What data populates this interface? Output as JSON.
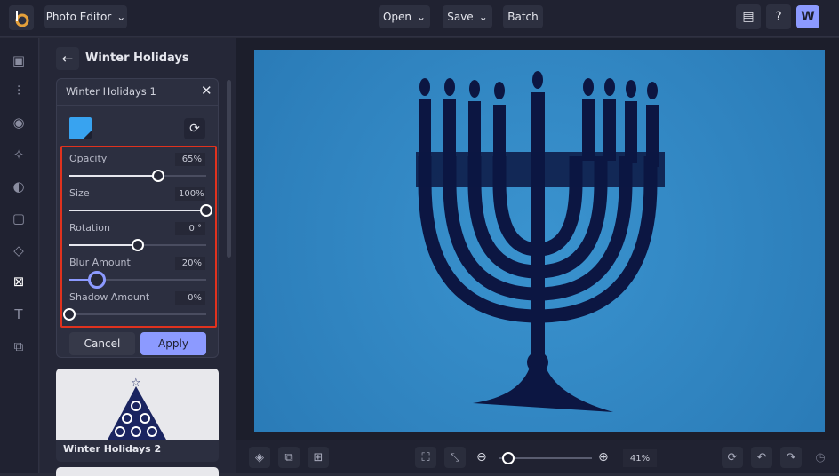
{
  "topbar": {
    "app_menu": "Photo Editor",
    "open": "Open",
    "save": "Save",
    "batch": "Batch",
    "avatar": "W"
  },
  "panel": {
    "title": "Winter Holidays",
    "card_title": "Winter Holidays 1",
    "sliders": [
      {
        "label": "Opacity",
        "value": "65%",
        "fraction": 0.65
      },
      {
        "label": "Size",
        "value": "100%",
        "fraction": 1.0
      },
      {
        "label": "Rotation",
        "value": "0 °",
        "fraction": 0.5
      },
      {
        "label": "Blur Amount",
        "value": "20%",
        "fraction": 0.2
      },
      {
        "label": "Shadow Amount",
        "value": "0%",
        "fraction": 0
      }
    ],
    "cancel": "Cancel",
    "apply": "Apply",
    "thumb2_label": "Winter Holidays 2"
  },
  "bottom": {
    "zoom": "41%",
    "zoom_fraction": 0.1
  },
  "colors": {
    "accent": "#8c9aff",
    "highlight": "#e0321e",
    "canvas_bg": "#2f86c4"
  }
}
